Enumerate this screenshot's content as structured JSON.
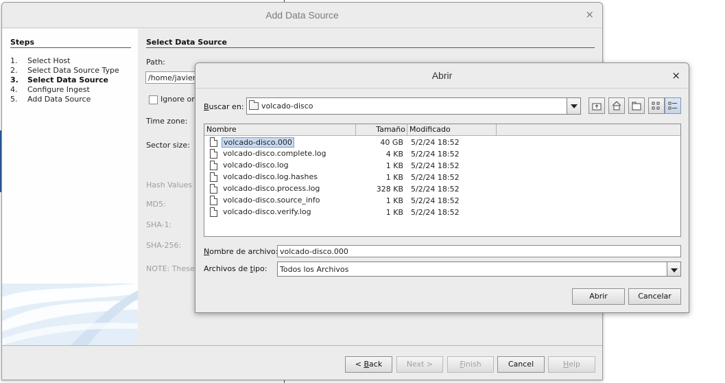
{
  "wizard": {
    "title": "Add Data Source",
    "close_glyph": "×",
    "steps_heading": "Steps",
    "steps": [
      {
        "num": "1.",
        "label": "Select Host",
        "current": false
      },
      {
        "num": "2.",
        "label": "Select Data Source Type",
        "current": false
      },
      {
        "num": "3.",
        "label": "Select Data Source",
        "current": true
      },
      {
        "num": "4.",
        "label": "Configure Ingest",
        "current": false
      },
      {
        "num": "5.",
        "label": "Add Data Source",
        "current": false
      }
    ],
    "content_title": "Select Data Source",
    "path_label": "Path:",
    "path_value": "/home/javiercc",
    "ignore_orphan_label": "Ignore orp",
    "time_zone_label": "Time zone:",
    "sector_size_label": "Sector size:",
    "hash_values_label": "Hash Values (c",
    "md5_label": "MD5:",
    "sha1_label": "SHA-1:",
    "sha256_label": "SHA-256:",
    "note_label": "NOTE: These v",
    "buttons": {
      "back_prefix": "< ",
      "back_mnemonic": "B",
      "back_rest": "ack",
      "next": "Next >",
      "finish_mnemonic": "F",
      "finish_rest": "inish",
      "cancel": "Cancel",
      "help_mnemonic": "H",
      "help_rest": "elp"
    }
  },
  "chooser": {
    "title": "Abrir",
    "close_glyph": "×",
    "look_in_mnemonic": "B",
    "look_in_rest": "uscar en:",
    "look_in_value": "volcado-disco",
    "columns": {
      "name": "Nombre",
      "size": "Tamaño",
      "modified": "Modificado"
    },
    "files": [
      {
        "name": "volcado-disco.000",
        "size": "40 GB",
        "modified": "5/2/24 18:52",
        "selected": true
      },
      {
        "name": "volcado-disco.complete.log",
        "size": "4 KB",
        "modified": "5/2/24 18:52",
        "selected": false
      },
      {
        "name": "volcado-disco.log",
        "size": "1 KB",
        "modified": "5/2/24 18:52",
        "selected": false
      },
      {
        "name": "volcado-disco.log.hashes",
        "size": "1 KB",
        "modified": "5/2/24 18:52",
        "selected": false
      },
      {
        "name": "volcado-disco.process.log",
        "size": "328 KB",
        "modified": "5/2/24 18:52",
        "selected": false
      },
      {
        "name": "volcado-disco.source_info",
        "size": "1 KB",
        "modified": "5/2/24 18:52",
        "selected": false
      },
      {
        "name": "volcado-disco.verify.log",
        "size": "1 KB",
        "modified": "5/2/24 18:52",
        "selected": false
      }
    ],
    "filename_mnemonic": "N",
    "filename_rest": "ombre de archivo:",
    "filename_value": "volcado-disco.000",
    "filetype_prefix": "Archivos de ",
    "filetype_mnemonic": "t",
    "filetype_rest": "ipo:",
    "filetype_value": "Todos los Archivos",
    "open_button": "Abrir",
    "cancel_button": "Cancelar"
  },
  "colors": {
    "selection": "#c8daf0",
    "accent": "#2b5e99"
  }
}
